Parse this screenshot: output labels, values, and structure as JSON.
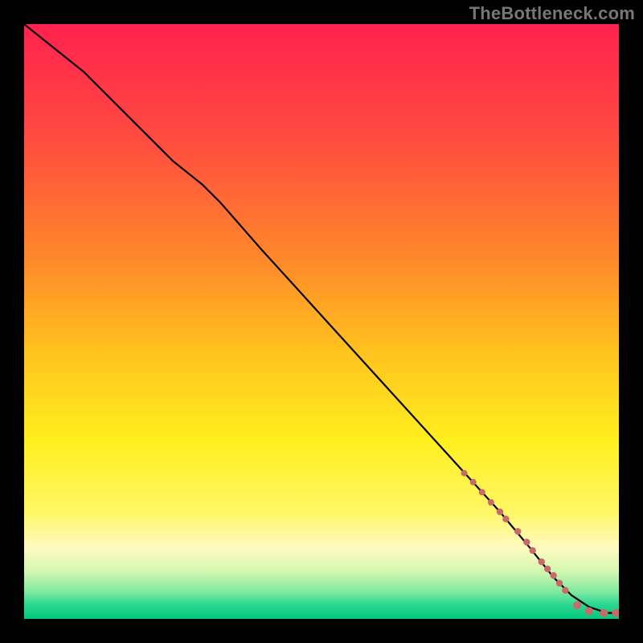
{
  "watermark": "TheBottleneck.com",
  "chart_data": {
    "type": "line",
    "title": "",
    "xlabel": "",
    "ylabel": "",
    "xlim": [
      0,
      100
    ],
    "ylim": [
      0,
      100
    ],
    "gradient_stops": [
      {
        "offset": 0,
        "color": "#ff214e"
      },
      {
        "offset": 0.2,
        "color": "#ff4d3f"
      },
      {
        "offset": 0.4,
        "color": "#ff8a2a"
      },
      {
        "offset": 0.55,
        "color": "#ffc21e"
      },
      {
        "offset": 0.7,
        "color": "#ffef1e"
      },
      {
        "offset": 0.82,
        "color": "#fff765"
      },
      {
        "offset": 0.88,
        "color": "#fffabf"
      },
      {
        "offset": 0.92,
        "color": "#d3f7b0"
      },
      {
        "offset": 0.955,
        "color": "#7ee9a0"
      },
      {
        "offset": 0.975,
        "color": "#2dd892"
      },
      {
        "offset": 1.0,
        "color": "#00c97b"
      }
    ],
    "series": [
      {
        "name": "bottleneck-curve",
        "stroke": "#000000",
        "stroke_width": 2.2,
        "x": [
          0,
          5,
          10,
          15,
          20,
          25,
          30,
          33,
          40,
          50,
          60,
          70,
          80,
          85,
          89,
          92,
          95,
          98,
          100
        ],
        "y": [
          100,
          96,
          92,
          87,
          82,
          77,
          73,
          70,
          62,
          51,
          40,
          29,
          18,
          12,
          7,
          4,
          2,
          1,
          1
        ]
      }
    ],
    "markers": {
      "name": "highlight-points",
      "color": "#c96a6a",
      "points": [
        {
          "x": 74.0,
          "y": 24.5,
          "r": 4.0
        },
        {
          "x": 75.5,
          "y": 23.0,
          "r": 4.0
        },
        {
          "x": 77.0,
          "y": 21.3,
          "r": 4.0
        },
        {
          "x": 78.5,
          "y": 19.6,
          "r": 4.0
        },
        {
          "x": 80.0,
          "y": 18.0,
          "r": 4.2
        },
        {
          "x": 81.0,
          "y": 16.8,
          "r": 4.2
        },
        {
          "x": 83.0,
          "y": 14.7,
          "r": 4.2
        },
        {
          "x": 84.5,
          "y": 12.9,
          "r": 4.2
        },
        {
          "x": 85.5,
          "y": 11.5,
          "r": 4.2
        },
        {
          "x": 87.0,
          "y": 9.6,
          "r": 4.2
        },
        {
          "x": 88.0,
          "y": 8.4,
          "r": 4.2
        },
        {
          "x": 89.0,
          "y": 7.3,
          "r": 4.2
        },
        {
          "x": 90.0,
          "y": 6.0,
          "r": 4.2
        },
        {
          "x": 91.0,
          "y": 4.8,
          "r": 4.2
        },
        {
          "x": 93.0,
          "y": 2.3,
          "r": 5.0
        },
        {
          "x": 95.0,
          "y": 1.3,
          "r": 5.0
        },
        {
          "x": 97.5,
          "y": 1.0,
          "r": 5.0
        },
        {
          "x": 99.5,
          "y": 1.0,
          "r": 5.0
        }
      ]
    }
  }
}
